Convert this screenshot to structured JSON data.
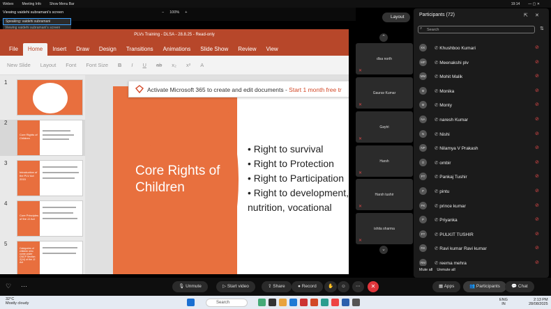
{
  "topbar": {
    "app": "Webex",
    "meeting_info": "Meeting Info",
    "menu_bar": "Show Menu Bar",
    "clock": "19:14"
  },
  "share": {
    "viewing": "Viewing vaidehi subramani's screen",
    "zoom": "100%",
    "speaking": "Speaking: vaidehi subramani",
    "viewing_tag": "Viewing vaidehi subramani's screen"
  },
  "ppt": {
    "title": "PLVs Training - DLSA - 28.8.25 - Read-only",
    "tabs": [
      "File",
      "Home",
      "Insert",
      "Draw",
      "Design",
      "Transitions",
      "Animations",
      "Slide Show",
      "Review",
      "View"
    ],
    "ribbon": [
      "New Slide",
      "Layout",
      "Font",
      "Font Size"
    ],
    "thumb_numbers": [
      "1",
      "2",
      "3",
      "4",
      "5"
    ],
    "thumb_titles": [
      "",
      "Core Rights of Children",
      "Introduction of the PLV Act 2015",
      "Core Principles of the JJ Act",
      "Categories of children who come under CNCP Section 2(14) of the JJ Act"
    ],
    "banner": "Activate Microsoft 365 to create and edit documents - ",
    "banner_link": "Start 1 month free tr",
    "slide_title": "Core Rights of Children",
    "bullets": [
      "Right to survival",
      "Right to Protection",
      "Right to Participation",
      "Right to development, nutrition, vocational"
    ]
  },
  "video": {
    "layout": "Layout",
    "tiles": [
      "dlsa north",
      "Gaurav Kumar",
      "Gaytri",
      "Harsh",
      "Harsh tushir",
      "ishita sharma"
    ]
  },
  "participants": {
    "header": "Participants (72)",
    "search_placeholder": "Search",
    "list": [
      {
        "initials": "KK",
        "name": "Khushboo Kumari"
      },
      {
        "initials": "MP",
        "name": "Meenakshi plv"
      },
      {
        "initials": "MM",
        "name": "Mohit Malik"
      },
      {
        "initials": "M",
        "name": "Monika"
      },
      {
        "initials": "M",
        "name": "Monty"
      },
      {
        "initials": "NA",
        "name": "naresh Kumar"
      },
      {
        "initials": "N",
        "name": "Nishi"
      },
      {
        "initials": "NP",
        "name": "Nilamya V Prakash"
      },
      {
        "initials": "O",
        "name": "ombir"
      },
      {
        "initials": "PT",
        "name": "Pankaj Tushir"
      },
      {
        "initials": "P",
        "name": "pintu"
      },
      {
        "initials": "PK",
        "name": "prince kumar"
      },
      {
        "initials": "P",
        "name": "Priyanka"
      },
      {
        "initials": "PT",
        "name": "PULKIT TUSHIR"
      },
      {
        "initials": "RK",
        "name": "Ravi kumar Ravi kumar"
      },
      {
        "initials": "RM",
        "name": "reema mehra"
      }
    ],
    "mute_all": "Mute all",
    "unmute_all": "Unmute all"
  },
  "controls": {
    "unmute": "Unmute",
    "start_video": "Start video",
    "share": "Share",
    "record": "Record",
    "apps": "Apps",
    "participants": "Participants",
    "chat": "Chat"
  },
  "taskbar": {
    "weather_temp": "32°C",
    "weather_desc": "Mostly cloudy",
    "search": "Search",
    "lang": "ENG",
    "region": "IN",
    "time": "2:13 PM",
    "date": "28/08/2025"
  }
}
